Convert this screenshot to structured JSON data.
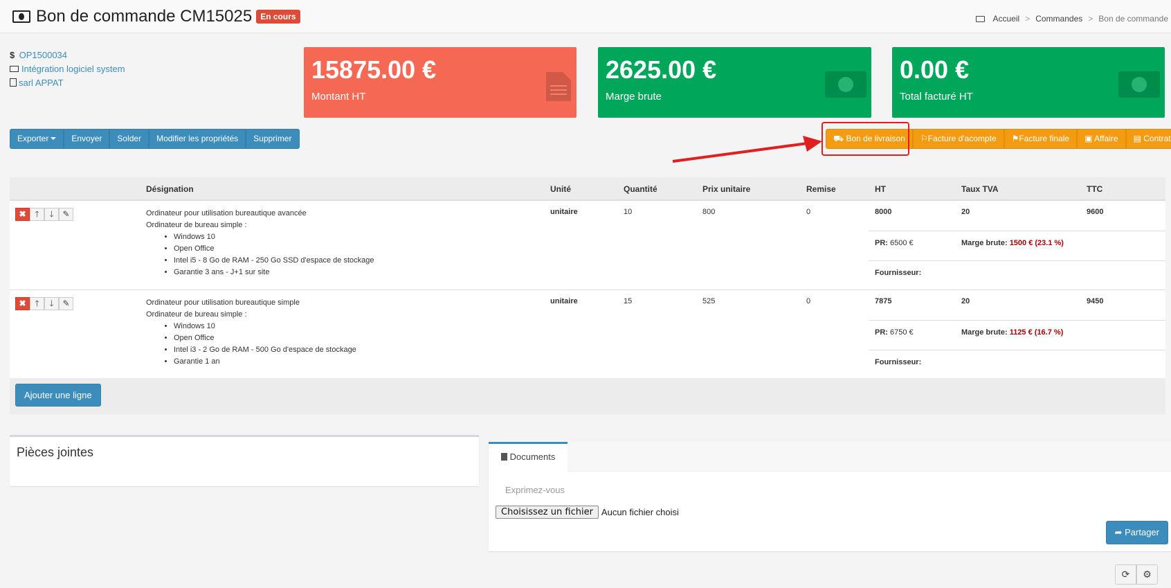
{
  "header": {
    "title": "Bon de commande CM15025",
    "status": "En cours",
    "breadcrumb": [
      "Accueil",
      "Commandes",
      "Bon de commande"
    ]
  },
  "meta": {
    "op": "OP1500034",
    "project": "Intégration logiciel system",
    "client": "sarl APPAT"
  },
  "stats": [
    {
      "value": "15875.00 €",
      "label": "Montant HT",
      "color": "#f56954",
      "icon": "file-icon"
    },
    {
      "value": "2625.00 €",
      "label": "Marge brute",
      "color": "#00a65a",
      "icon": "money-icon"
    },
    {
      "value": "0.00 €",
      "label": "Total facturé HT",
      "color": "#00a65a",
      "icon": "money-icon"
    }
  ],
  "actions": {
    "export": "Exporter",
    "send": "Envoyer",
    "settle": "Solder",
    "edit": "Modifier les propriétés",
    "delete": "Supprimer"
  },
  "documents_buttons": {
    "delivery": "Bon de livraison",
    "deposit_invoice": "Facture d'acompte",
    "final_invoice": "Facture finale",
    "deal": "Affaire",
    "contract": "Contrat"
  },
  "table": {
    "columns": {
      "designation": "Désignation",
      "unit": "Unité",
      "qty": "Quantité",
      "price": "Prix unitaire",
      "discount": "Remise",
      "ht": "HT",
      "vat": "Taux TVA",
      "ttc": "TTC"
    },
    "rows": [
      {
        "title": "Ordinateur pour utilisation bureautique avancée",
        "subtitle": "Ordinateur de bureau simple :",
        "bullets": [
          "Windows 10",
          "Open Office",
          "Intel i5 - 8 Go de RAM - 250 Go SSD d'espace de stockage",
          "Garantie 3 ans - J+1 sur site"
        ],
        "unit": "unitaire",
        "qty": "10",
        "price": "800",
        "discount": "0",
        "ht": "8000",
        "vat": "20",
        "ttc": "9600",
        "pr_label": "PR:",
        "pr": "6500 €",
        "margin_label": "Marge brute:",
        "margin": "1500 € (23.1 %)",
        "supplier_label": "Fournisseur:"
      },
      {
        "title": "Ordinateur pour utilisation bureautique simple",
        "subtitle": "Ordinateur de bureau simple :",
        "bullets": [
          "Windows 10",
          "Open Office",
          "Intel i3 - 2 Go de RAM - 500 Go d'espace de stockage",
          "Garantie 1 an"
        ],
        "unit": "unitaire",
        "qty": "15",
        "price": "525",
        "discount": "0",
        "ht": "7875",
        "vat": "20",
        "ttc": "9450",
        "pr_label": "PR:",
        "pr": "6750 €",
        "margin_label": "Marge brute:",
        "margin": "1125 € (16.7 %)",
        "supplier_label": "Fournisseur:"
      }
    ],
    "add_line": "Ajouter une ligne"
  },
  "attachments": {
    "title": "Pièces jointes"
  },
  "docs_panel": {
    "tab": "Documents",
    "placeholder": "Exprimez-vous",
    "file_button": "Choisissez un fichier",
    "file_none": "Aucun fichier choisi",
    "share": "Partager"
  }
}
